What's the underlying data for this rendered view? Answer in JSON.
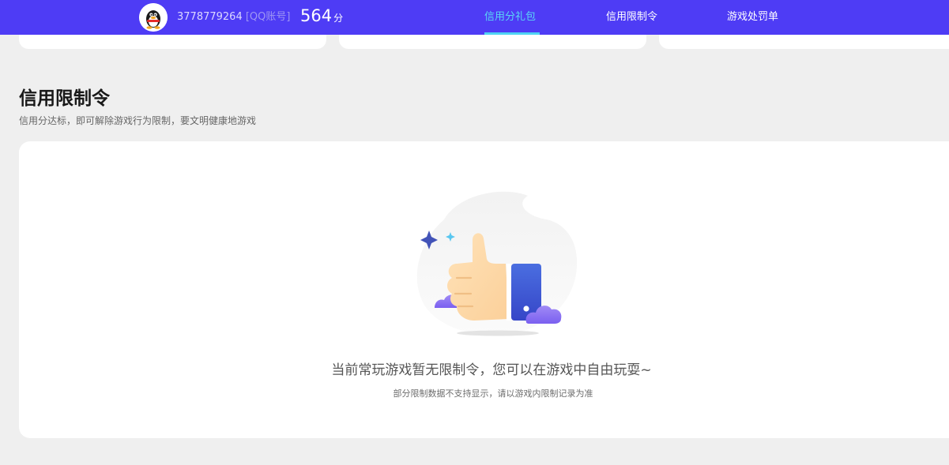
{
  "header": {
    "account_id": "3778779264",
    "account_type": "[QQ账号]",
    "score_value": "564",
    "score_unit": "分",
    "tabs": [
      {
        "label": "信用分礼包",
        "active": true
      },
      {
        "label": "信用限制令",
        "active": false
      },
      {
        "label": "游戏处罚单",
        "active": false
      }
    ],
    "colors": {
      "bar": "#4e3cf5",
      "active_tab": "#59d7f5"
    }
  },
  "section": {
    "title": "信用限制令",
    "subtitle": "信用分达标，即可解除游戏行为限制，要文明健康地游戏"
  },
  "empty_state": {
    "icon": "thumbs-up-illustration",
    "message": "当前常玩游戏暂无限制令，您可以在游戏中自由玩耍~",
    "note": "部分限制数据不支持显示，请以游戏内限制记录为准"
  }
}
